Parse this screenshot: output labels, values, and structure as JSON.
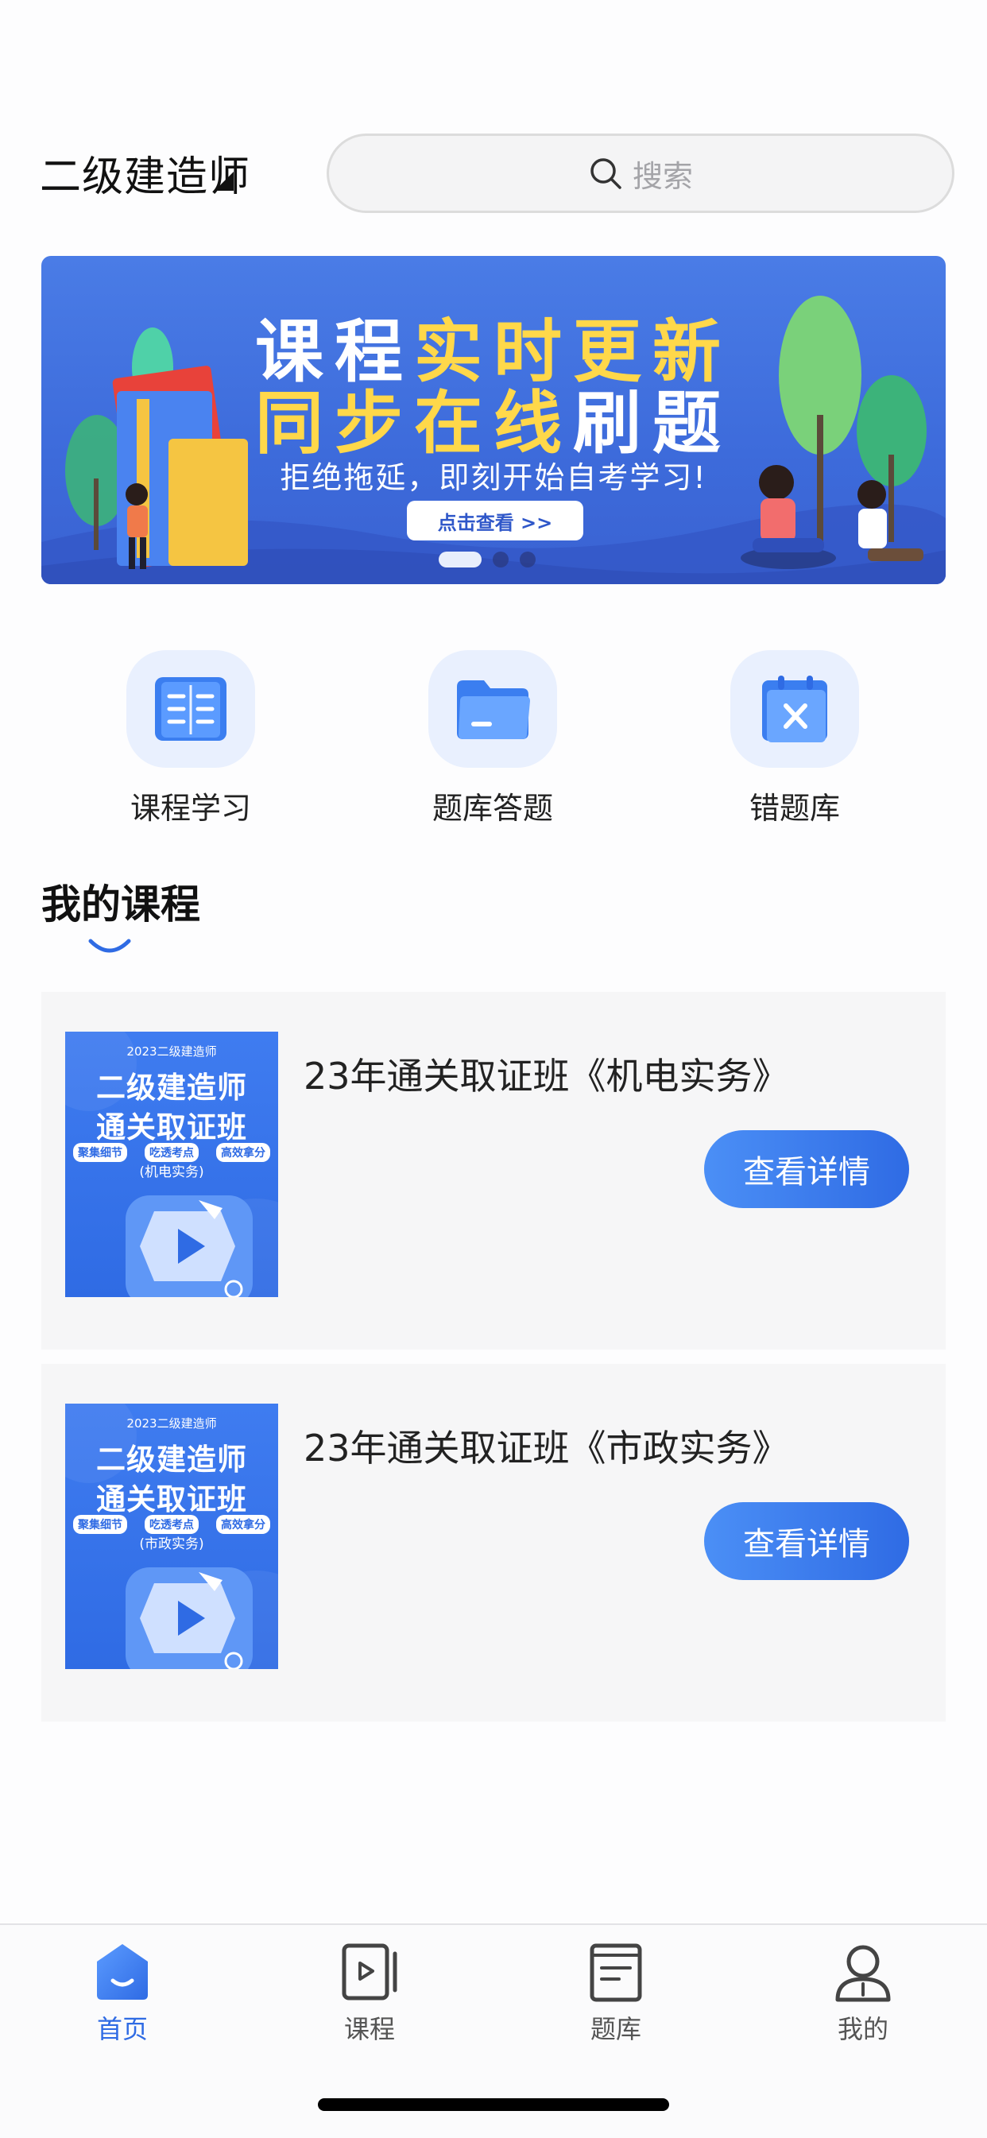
{
  "header": {
    "exam_name": "二级建造师",
    "search_placeholder": "搜索"
  },
  "banner": {
    "line1_white": "课程",
    "line1_yellow": "实时更新",
    "line2_yellow": "同步在线",
    "line2_white": "刷题",
    "subtitle": "拒绝拖延，即刻开始自考学习!",
    "button_label": "点击查看 >>",
    "slide_count": 3,
    "active_slide": 1
  },
  "quick_entries": [
    {
      "label": "课程学习",
      "icon": "book-open-icon"
    },
    {
      "label": "题库答题",
      "icon": "folder-icon"
    },
    {
      "label": "错题库",
      "icon": "calendar-x-icon"
    }
  ],
  "my_courses": {
    "title": "我的课程",
    "items": [
      {
        "title": "23年通关取证班《机电实务》",
        "button_label": "查看详情",
        "thumb": {
          "year": "2023二级建造师",
          "heading1": "二级建造师",
          "heading2": "通关取证班",
          "tags": [
            "聚集细节",
            "吃透考点",
            "高效拿分"
          ],
          "subject": "(机电实务)"
        }
      },
      {
        "title": "23年通关取证班《市政实务》",
        "button_label": "查看详情",
        "thumb": {
          "year": "2023二级建造师",
          "heading1": "二级建造师",
          "heading2": "通关取证班",
          "tags": [
            "聚集细节",
            "吃透考点",
            "高效拿分"
          ],
          "subject": "(市政实务)"
        }
      }
    ]
  },
  "tabbar": {
    "items": [
      {
        "label": "首页",
        "icon": "home-icon",
        "active": true
      },
      {
        "label": "课程",
        "icon": "video-icon",
        "active": false
      },
      {
        "label": "题库",
        "icon": "document-icon",
        "active": false
      },
      {
        "label": "我的",
        "icon": "user-icon",
        "active": false
      }
    ]
  },
  "colors": {
    "accent": "#2f6be4",
    "banner_bg": "#4a7ce6",
    "banner_highlight": "#ffd84a"
  }
}
